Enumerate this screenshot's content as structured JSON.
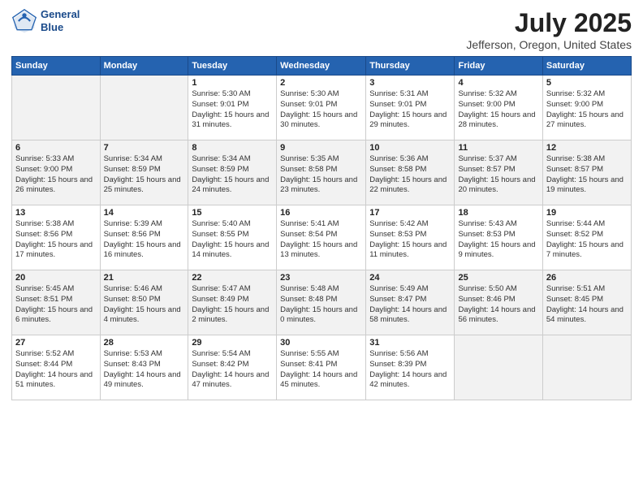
{
  "header": {
    "logo_line1": "General",
    "logo_line2": "Blue",
    "title": "July 2025",
    "subtitle": "Jefferson, Oregon, United States"
  },
  "days_of_week": [
    "Sunday",
    "Monday",
    "Tuesday",
    "Wednesday",
    "Thursday",
    "Friday",
    "Saturday"
  ],
  "weeks": [
    [
      {
        "day": "",
        "sunrise": "",
        "sunset": "",
        "daylight": ""
      },
      {
        "day": "",
        "sunrise": "",
        "sunset": "",
        "daylight": ""
      },
      {
        "day": "1",
        "sunrise": "Sunrise: 5:30 AM",
        "sunset": "Sunset: 9:01 PM",
        "daylight": "Daylight: 15 hours and 31 minutes."
      },
      {
        "day": "2",
        "sunrise": "Sunrise: 5:30 AM",
        "sunset": "Sunset: 9:01 PM",
        "daylight": "Daylight: 15 hours and 30 minutes."
      },
      {
        "day": "3",
        "sunrise": "Sunrise: 5:31 AM",
        "sunset": "Sunset: 9:01 PM",
        "daylight": "Daylight: 15 hours and 29 minutes."
      },
      {
        "day": "4",
        "sunrise": "Sunrise: 5:32 AM",
        "sunset": "Sunset: 9:00 PM",
        "daylight": "Daylight: 15 hours and 28 minutes."
      },
      {
        "day": "5",
        "sunrise": "Sunrise: 5:32 AM",
        "sunset": "Sunset: 9:00 PM",
        "daylight": "Daylight: 15 hours and 27 minutes."
      }
    ],
    [
      {
        "day": "6",
        "sunrise": "Sunrise: 5:33 AM",
        "sunset": "Sunset: 9:00 PM",
        "daylight": "Daylight: 15 hours and 26 minutes."
      },
      {
        "day": "7",
        "sunrise": "Sunrise: 5:34 AM",
        "sunset": "Sunset: 8:59 PM",
        "daylight": "Daylight: 15 hours and 25 minutes."
      },
      {
        "day": "8",
        "sunrise": "Sunrise: 5:34 AM",
        "sunset": "Sunset: 8:59 PM",
        "daylight": "Daylight: 15 hours and 24 minutes."
      },
      {
        "day": "9",
        "sunrise": "Sunrise: 5:35 AM",
        "sunset": "Sunset: 8:58 PM",
        "daylight": "Daylight: 15 hours and 23 minutes."
      },
      {
        "day": "10",
        "sunrise": "Sunrise: 5:36 AM",
        "sunset": "Sunset: 8:58 PM",
        "daylight": "Daylight: 15 hours and 22 minutes."
      },
      {
        "day": "11",
        "sunrise": "Sunrise: 5:37 AM",
        "sunset": "Sunset: 8:57 PM",
        "daylight": "Daylight: 15 hours and 20 minutes."
      },
      {
        "day": "12",
        "sunrise": "Sunrise: 5:38 AM",
        "sunset": "Sunset: 8:57 PM",
        "daylight": "Daylight: 15 hours and 19 minutes."
      }
    ],
    [
      {
        "day": "13",
        "sunrise": "Sunrise: 5:38 AM",
        "sunset": "Sunset: 8:56 PM",
        "daylight": "Daylight: 15 hours and 17 minutes."
      },
      {
        "day": "14",
        "sunrise": "Sunrise: 5:39 AM",
        "sunset": "Sunset: 8:56 PM",
        "daylight": "Daylight: 15 hours and 16 minutes."
      },
      {
        "day": "15",
        "sunrise": "Sunrise: 5:40 AM",
        "sunset": "Sunset: 8:55 PM",
        "daylight": "Daylight: 15 hours and 14 minutes."
      },
      {
        "day": "16",
        "sunrise": "Sunrise: 5:41 AM",
        "sunset": "Sunset: 8:54 PM",
        "daylight": "Daylight: 15 hours and 13 minutes."
      },
      {
        "day": "17",
        "sunrise": "Sunrise: 5:42 AM",
        "sunset": "Sunset: 8:53 PM",
        "daylight": "Daylight: 15 hours and 11 minutes."
      },
      {
        "day": "18",
        "sunrise": "Sunrise: 5:43 AM",
        "sunset": "Sunset: 8:53 PM",
        "daylight": "Daylight: 15 hours and 9 minutes."
      },
      {
        "day": "19",
        "sunrise": "Sunrise: 5:44 AM",
        "sunset": "Sunset: 8:52 PM",
        "daylight": "Daylight: 15 hours and 7 minutes."
      }
    ],
    [
      {
        "day": "20",
        "sunrise": "Sunrise: 5:45 AM",
        "sunset": "Sunset: 8:51 PM",
        "daylight": "Daylight: 15 hours and 6 minutes."
      },
      {
        "day": "21",
        "sunrise": "Sunrise: 5:46 AM",
        "sunset": "Sunset: 8:50 PM",
        "daylight": "Daylight: 15 hours and 4 minutes."
      },
      {
        "day": "22",
        "sunrise": "Sunrise: 5:47 AM",
        "sunset": "Sunset: 8:49 PM",
        "daylight": "Daylight: 15 hours and 2 minutes."
      },
      {
        "day": "23",
        "sunrise": "Sunrise: 5:48 AM",
        "sunset": "Sunset: 8:48 PM",
        "daylight": "Daylight: 15 hours and 0 minutes."
      },
      {
        "day": "24",
        "sunrise": "Sunrise: 5:49 AM",
        "sunset": "Sunset: 8:47 PM",
        "daylight": "Daylight: 14 hours and 58 minutes."
      },
      {
        "day": "25",
        "sunrise": "Sunrise: 5:50 AM",
        "sunset": "Sunset: 8:46 PM",
        "daylight": "Daylight: 14 hours and 56 minutes."
      },
      {
        "day": "26",
        "sunrise": "Sunrise: 5:51 AM",
        "sunset": "Sunset: 8:45 PM",
        "daylight": "Daylight: 14 hours and 54 minutes."
      }
    ],
    [
      {
        "day": "27",
        "sunrise": "Sunrise: 5:52 AM",
        "sunset": "Sunset: 8:44 PM",
        "daylight": "Daylight: 14 hours and 51 minutes."
      },
      {
        "day": "28",
        "sunrise": "Sunrise: 5:53 AM",
        "sunset": "Sunset: 8:43 PM",
        "daylight": "Daylight: 14 hours and 49 minutes."
      },
      {
        "day": "29",
        "sunrise": "Sunrise: 5:54 AM",
        "sunset": "Sunset: 8:42 PM",
        "daylight": "Daylight: 14 hours and 47 minutes."
      },
      {
        "day": "30",
        "sunrise": "Sunrise: 5:55 AM",
        "sunset": "Sunset: 8:41 PM",
        "daylight": "Daylight: 14 hours and 45 minutes."
      },
      {
        "day": "31",
        "sunrise": "Sunrise: 5:56 AM",
        "sunset": "Sunset: 8:39 PM",
        "daylight": "Daylight: 14 hours and 42 minutes."
      },
      {
        "day": "",
        "sunrise": "",
        "sunset": "",
        "daylight": ""
      },
      {
        "day": "",
        "sunrise": "",
        "sunset": "",
        "daylight": ""
      }
    ]
  ]
}
